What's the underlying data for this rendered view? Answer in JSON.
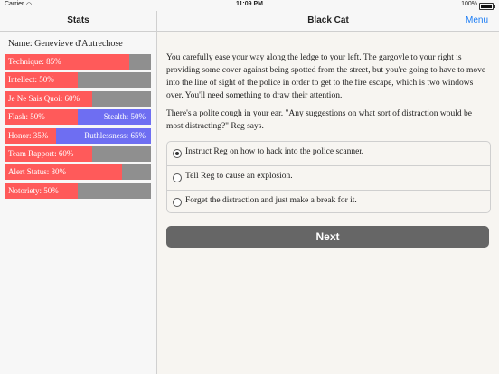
{
  "status_bar": {
    "carrier": "Carrier",
    "time": "11:09 PM",
    "battery": "100%"
  },
  "sidebar": {
    "title": "Stats",
    "name_line": "Name: Genevieve d'Autrechose",
    "stats": [
      {
        "label": "Technique: 85%",
        "value": 0.85
      },
      {
        "label": "Intellect: 50%",
        "value": 0.5
      },
      {
        "label": "Je Ne Sais Quoi: 60%",
        "value": 0.6
      },
      {
        "label": "Flash: 50%",
        "right_label": "Stealth: 50%",
        "value": 0.5
      },
      {
        "label": "Honor: 35%",
        "right_label": "Ruthlessness: 65%",
        "value": 0.35
      },
      {
        "label": "Team Rapport: 60%",
        "value": 0.6
      },
      {
        "label": "Alert Status: 80%",
        "value": 0.8
      },
      {
        "label": "Notoriety: 50%",
        "value": 0.5
      }
    ]
  },
  "header": {
    "title": "Black Cat",
    "menu_label": "Menu"
  },
  "story": {
    "p1": "You carefully ease your way along the ledge to your left. The gargoyle to your right is providing some cover against being spotted from the street, but you're going to have to move into the line of sight of the police in order to get to the fire escape, which is two windows over. You'll need something to draw their attention.",
    "p2": "There's a polite cough in your ear. \"Any suggestions on what sort of distraction would be most distracting?\" Reg says."
  },
  "choices": [
    {
      "label": "Instruct Reg on how to hack into the police scanner.",
      "selected": true
    },
    {
      "label": "Tell Reg to cause an explosion.",
      "selected": false
    },
    {
      "label": "Forget the distraction and just make a break for it.",
      "selected": false
    }
  ],
  "next_label": "Next",
  "colors": {
    "stat_fill": "#ff5a5a",
    "opposed_fill": "#6e6ef2",
    "bar_track": "#8f8f8f",
    "menu_link": "#1a7cf5",
    "next_button": "#666666"
  }
}
